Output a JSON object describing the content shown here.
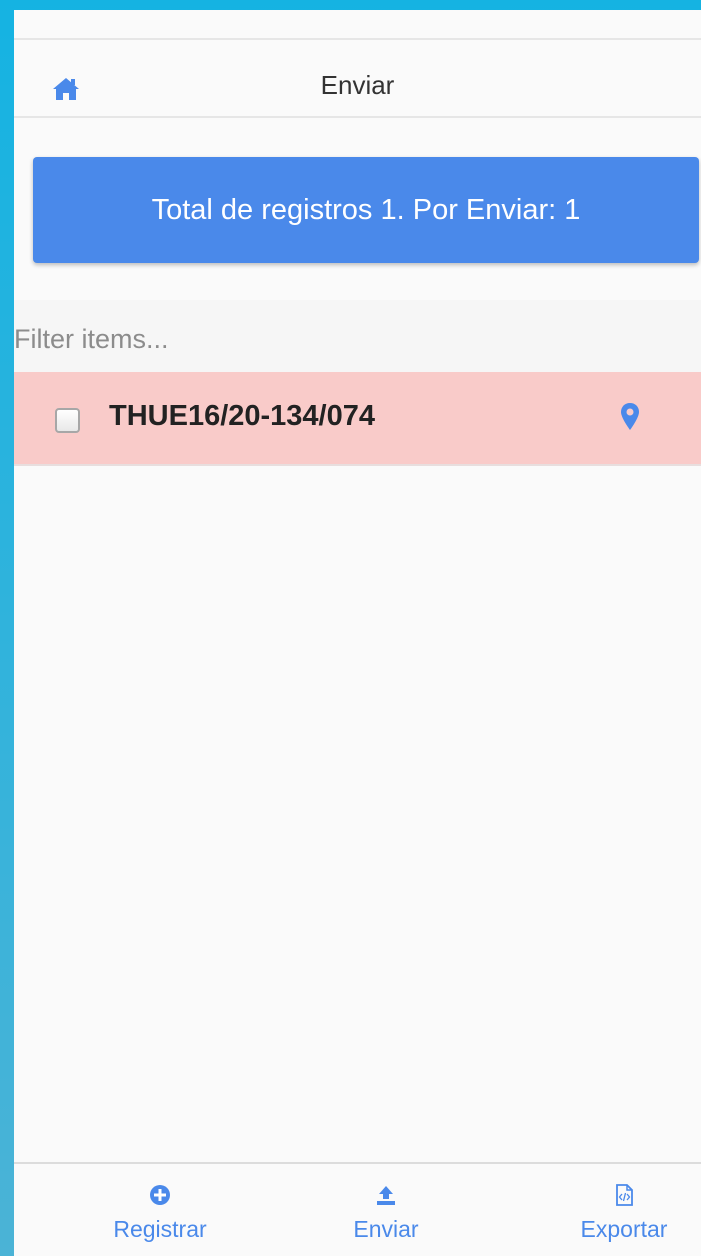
{
  "navbar": {
    "title": "Enviar",
    "home_icon": "home-icon"
  },
  "summary": {
    "text": "Total de registros 1. Por Enviar: 1"
  },
  "filter": {
    "placeholder": "Filter items...",
    "value": ""
  },
  "items": [
    {
      "label": "THUE16/20-134/074",
      "checked": false,
      "icon": "map-marker-icon"
    }
  ],
  "tabs": [
    {
      "label": "Registrar",
      "icon": "plus-circle-icon"
    },
    {
      "label": "Enviar",
      "icon": "upload-icon"
    },
    {
      "label": "Exportar",
      "icon": "file-code-icon"
    }
  ],
  "colors": {
    "accent": "#4a89ea",
    "item_highlight": "#f9cbc9",
    "frame": "#15b3e2",
    "background": "#fafafa"
  }
}
